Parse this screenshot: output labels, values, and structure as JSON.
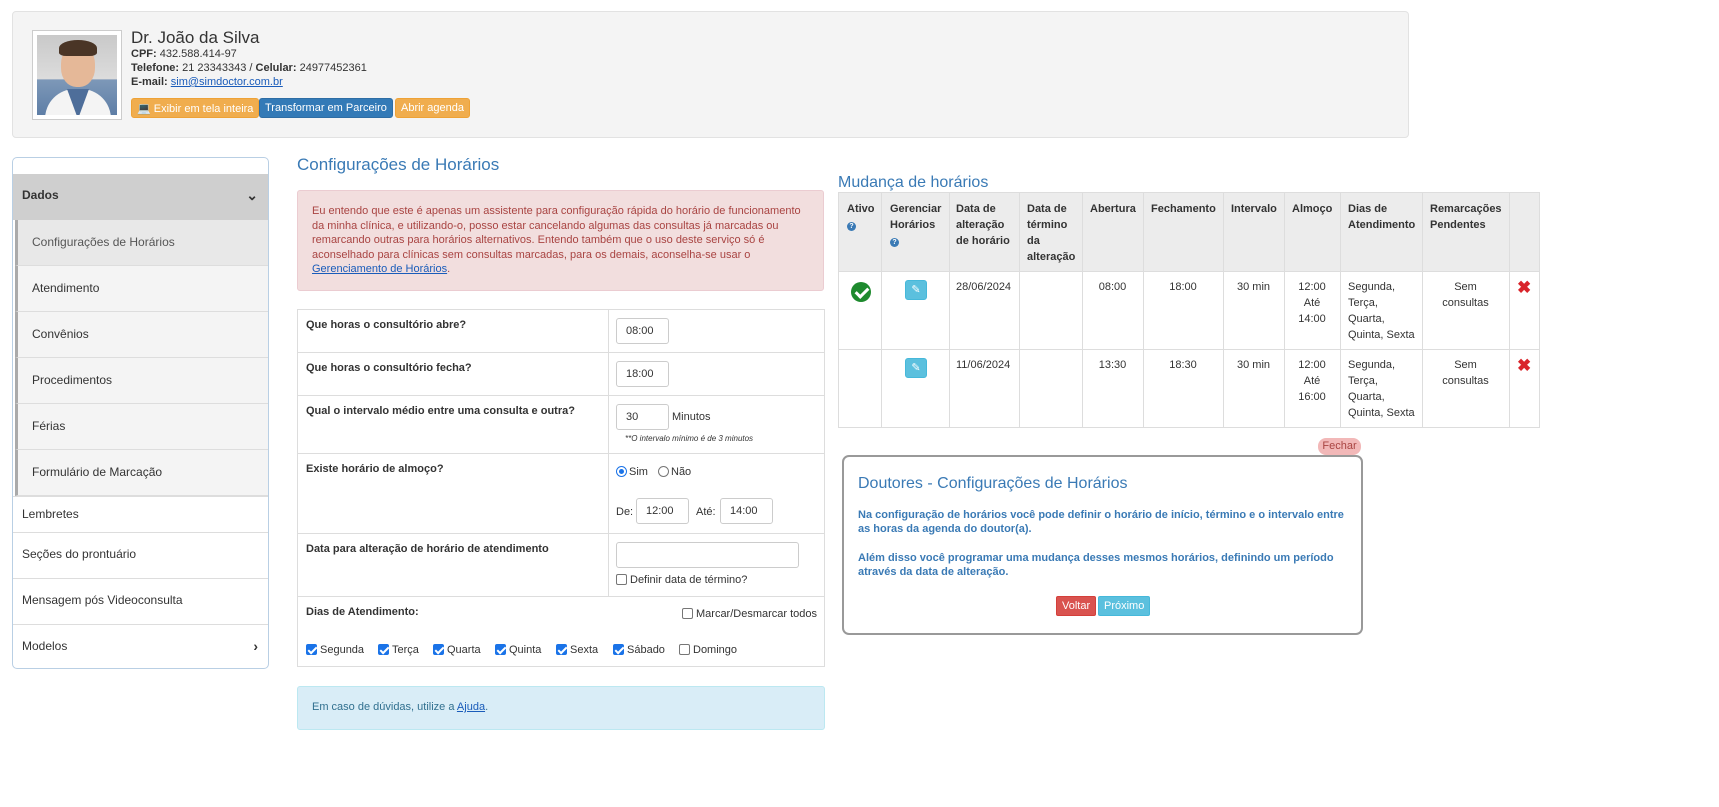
{
  "doctor": {
    "name": "Dr. João da Silva",
    "cpf_label": "CPF:",
    "cpf": "432.588.414-97",
    "phone_label": "Telefone:",
    "phone": "21 23343343",
    "mobile_label": "Celular:",
    "mobile": "24977452361",
    "email_label": "E-mail:",
    "email": "sim@simdoctor.com.br"
  },
  "header_buttons": {
    "fullscreen": "Exibir em tela inteira",
    "partner": "Transformar em Parceiro",
    "agenda": "Abrir agenda"
  },
  "sidebar": {
    "dados": "Dados",
    "sub_items": [
      "Configurações de Horários",
      "Atendimento",
      "Convênios",
      "Procedimentos",
      "Férias",
      "Formulário de Marcação"
    ],
    "items": [
      "Lembretes",
      "Seções do prontuário",
      "Mensagem pós Videoconsulta",
      "Modelos"
    ]
  },
  "config": {
    "title": "Configurações de Horários",
    "alert_text": "Eu entendo que este é apenas um assistente para configuração rápida do horário de funcionamento da minha clínica, e utilizando-o, posso estar cancelando algumas das consultas já marcadas ou remarcando outras para horários alternativos. Entendo também que o uso deste serviço só é aconselhado para clínicas sem consultas marcadas, para os demais, aconselha-se usar o ",
    "alert_link": "Gerenciamento de Horários",
    "alert_end": ".",
    "q_open": "Que horas o consultório abre?",
    "open_value": "08:00",
    "q_close": "Que horas o consultório fecha?",
    "close_value": "18:00",
    "q_interval": "Qual o intervalo médio entre uma consulta e outra?",
    "interval_value": "30",
    "interval_unit": "Minutos",
    "interval_note": "**O intervalo mínimo é de 3 minutos",
    "q_lunch": "Existe horário de almoço?",
    "lunch_yes": "Sim",
    "lunch_no": "Não",
    "lunch_from_label": "De:",
    "lunch_from": "12:00",
    "lunch_to_label": "Até:",
    "lunch_to": "14:00",
    "q_date": "Data para alteração de horário de atendimento",
    "date_value": "",
    "end_date_label": "Definir data de término?",
    "days_label": "Dias de Atendimento:",
    "toggle_all": "Marcar/Desmarcar todos",
    "days": [
      {
        "name": "Segunda",
        "checked": true
      },
      {
        "name": "Terça",
        "checked": true
      },
      {
        "name": "Quarta",
        "checked": true
      },
      {
        "name": "Quinta",
        "checked": true
      },
      {
        "name": "Sexta",
        "checked": true
      },
      {
        "name": "Sábado",
        "checked": true
      },
      {
        "name": "Domingo",
        "checked": false
      }
    ],
    "help_text": "Em caso de dúvidas, utilize a ",
    "help_link": "Ajuda",
    "help_end": "."
  },
  "changes": {
    "title": "Mudança de horários",
    "headers": {
      "ativo": "Ativo",
      "gerenciar": [
        "Gerenciar",
        "Horários"
      ],
      "data_alt": [
        "Data de",
        "alteração",
        "de horário"
      ],
      "data_term": [
        "Data de",
        "término",
        "da",
        "alteração"
      ],
      "abertura": "Abertura",
      "fechamento": "Fechamento",
      "intervalo": "Intervalo",
      "almoco": "Almoço",
      "dias": [
        "Dias de",
        "Atendimento"
      ],
      "remarc": [
        "Remarcações",
        "Pendentes"
      ]
    },
    "rows": [
      {
        "active": true,
        "date": "28/06/2024",
        "end": "",
        "open": "08:00",
        "close": "18:00",
        "interval": "30 min",
        "lunch_from": "12:00",
        "lunch_sep": "Até",
        "lunch_to": "14:00",
        "days": [
          "Segunda,",
          "Terça,",
          "Quarta,",
          "Quinta, Sexta"
        ],
        "pending": [
          "Sem",
          "consultas"
        ]
      },
      {
        "active": false,
        "date": "11/06/2024",
        "end": "",
        "open": "13:30",
        "close": "18:30",
        "interval": "30 min",
        "lunch_from": "12:00",
        "lunch_sep": "Até",
        "lunch_to": "16:00",
        "days": [
          "Segunda,",
          "Terça,",
          "Quarta,",
          "Quinta, Sexta"
        ],
        "pending": [
          "Sem",
          "consultas"
        ]
      }
    ]
  },
  "tour": {
    "close": "Fechar",
    "title": "Doutores - Configurações de Horários",
    "p1": "Na configuração de horários você pode definir o horário de início, término e o intervalo entre as horas da agenda do doutor(a).",
    "p2": "Além disso você programar uma mudança desses mesmos horários, definindo um período através da data de alteração.",
    "back": "Voltar",
    "next": "Próximo"
  },
  "colors": {
    "accent": "#3a7ab5",
    "orange": "#f0ad4e",
    "blue": "#337ab7",
    "danger": "#d9534f",
    "info": "#5bc0de"
  }
}
